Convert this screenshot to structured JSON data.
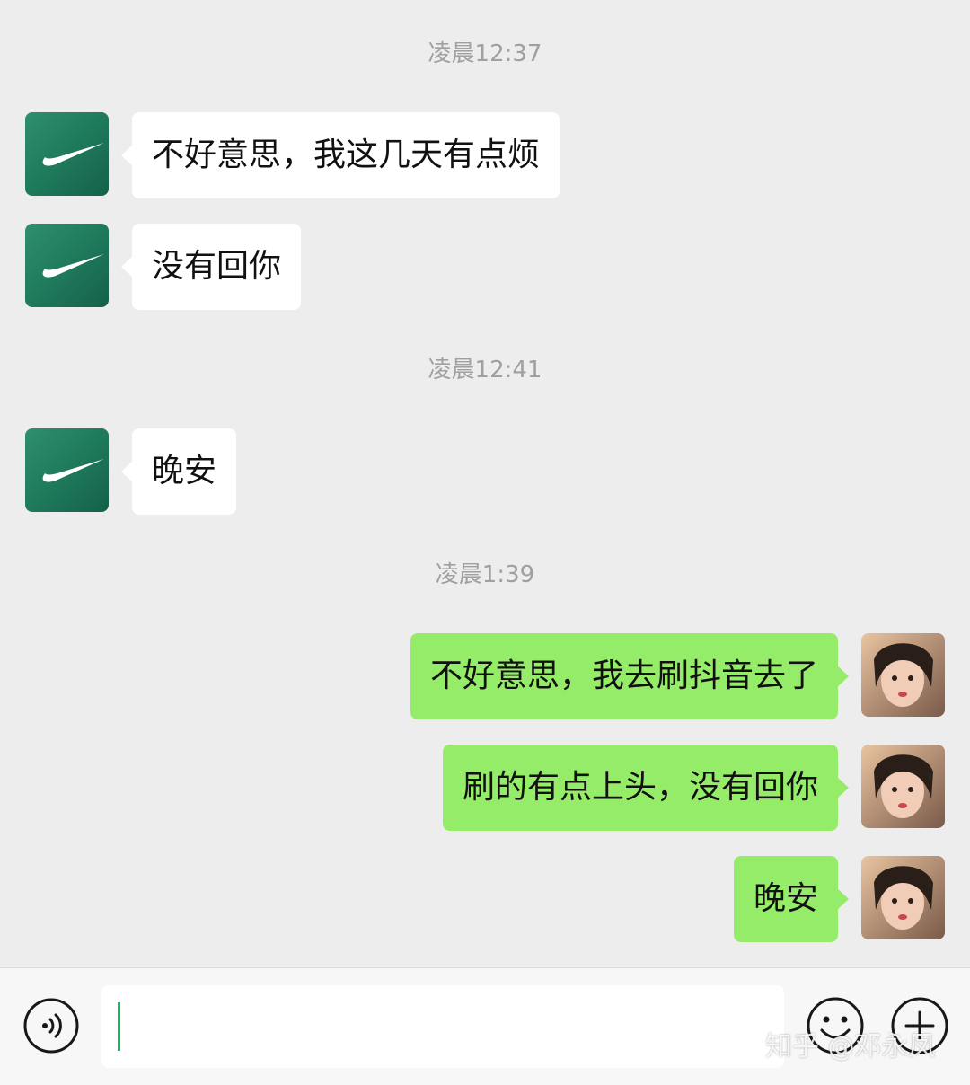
{
  "chat": {
    "timestamps": [
      "凌晨12:37",
      "凌晨12:41",
      "凌晨1:39"
    ],
    "messages": [
      {
        "side": "left",
        "text": "不好意思，我这几天有点烦"
      },
      {
        "side": "left",
        "text": "没有回你"
      },
      {
        "side": "left",
        "text": "晚安"
      },
      {
        "side": "right",
        "text": "不好意思，我去刷抖音去了"
      },
      {
        "side": "right",
        "text": "刷的有点上头，没有回你"
      },
      {
        "side": "right",
        "text": "晚安"
      }
    ]
  },
  "input_bar": {
    "text_value": "",
    "voice_icon": "voice-icon",
    "emoji_icon": "emoji-icon",
    "plus_icon": "plus-icon"
  },
  "watermark": "知乎 @邓永凤",
  "colors": {
    "background": "#ededed",
    "incoming_bubble": "#ffffff",
    "outgoing_bubble": "#95ec69",
    "timestamp_text": "#a0a0a0",
    "caret": "#07c160"
  }
}
